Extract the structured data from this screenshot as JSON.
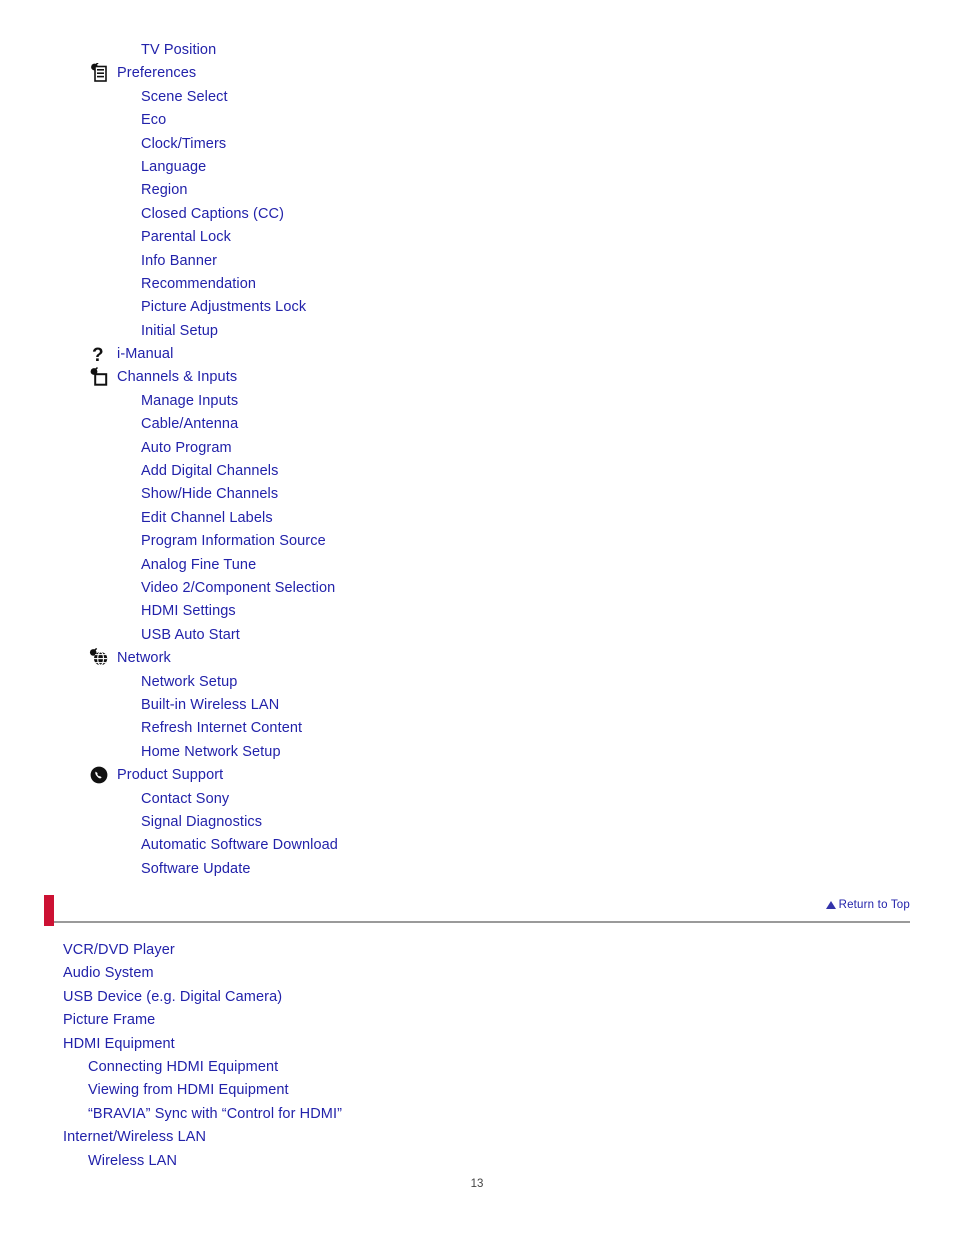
{
  "document": {
    "page_number": "13",
    "link_color": "#2222AA",
    "accent_bar_color": "#CC1133",
    "rule_color": "#9A9A9A"
  },
  "toc_top": {
    "items": [
      {
        "label": "TV Position",
        "level": "sub",
        "icon": null
      },
      {
        "label": "Preferences",
        "level": "icon",
        "icon": "preferences-list-icon"
      },
      {
        "label": "Scene Select",
        "level": "sub",
        "icon": null
      },
      {
        "label": "Eco",
        "level": "sub",
        "icon": null
      },
      {
        "label": "Clock/Timers",
        "level": "sub",
        "icon": null
      },
      {
        "label": "Language",
        "level": "sub",
        "icon": null
      },
      {
        "label": "Region",
        "level": "sub",
        "icon": null
      },
      {
        "label": "Closed Captions (CC)",
        "level": "sub",
        "icon": null
      },
      {
        "label": "Parental Lock",
        "level": "sub",
        "icon": null
      },
      {
        "label": "Info Banner",
        "level": "sub",
        "icon": null
      },
      {
        "label": "Recommendation",
        "level": "sub",
        "icon": null
      },
      {
        "label": "Picture Adjustments Lock",
        "level": "sub",
        "icon": null
      },
      {
        "label": "Initial Setup",
        "level": "sub",
        "icon": null
      },
      {
        "label": "i-Manual",
        "level": "icon",
        "icon": "question-mark-icon"
      },
      {
        "label": "Channels & Inputs",
        "level": "icon",
        "icon": "channels-inputs-icon"
      },
      {
        "label": "Manage Inputs",
        "level": "sub",
        "icon": null
      },
      {
        "label": "Cable/Antenna",
        "level": "sub",
        "icon": null
      },
      {
        "label": "Auto Program",
        "level": "sub",
        "icon": null
      },
      {
        "label": "Add Digital Channels",
        "level": "sub",
        "icon": null
      },
      {
        "label": "Show/Hide Channels",
        "level": "sub",
        "icon": null
      },
      {
        "label": "Edit Channel Labels",
        "level": "sub",
        "icon": null
      },
      {
        "label": "Program Information Source",
        "level": "sub",
        "icon": null
      },
      {
        "label": "Analog Fine Tune",
        "level": "sub",
        "icon": null
      },
      {
        "label": "Video 2/Component Selection",
        "level": "sub",
        "icon": null
      },
      {
        "label": "HDMI Settings",
        "level": "sub",
        "icon": null
      },
      {
        "label": "USB Auto Start",
        "level": "sub",
        "icon": null
      },
      {
        "label": "Network",
        "level": "icon",
        "icon": "globe-icon"
      },
      {
        "label": "Network Setup",
        "level": "sub",
        "icon": null
      },
      {
        "label": "Built-in Wireless LAN",
        "level": "sub",
        "icon": null
      },
      {
        "label": "Refresh Internet Content",
        "level": "sub",
        "icon": null
      },
      {
        "label": "Home Network Setup",
        "level": "sub",
        "icon": null
      },
      {
        "label": "Product Support",
        "level": "icon",
        "icon": "phone-icon"
      },
      {
        "label": "Contact Sony",
        "level": "sub",
        "icon": null
      },
      {
        "label": "Signal Diagnostics",
        "level": "sub",
        "icon": null
      },
      {
        "label": "Automatic Software Download",
        "level": "sub",
        "icon": null
      },
      {
        "label": "Software Update",
        "level": "sub",
        "icon": null
      }
    ]
  },
  "return_to_top": {
    "label": "Return to Top",
    "icon": "triangle-up-icon"
  },
  "toc_bottom": {
    "items": [
      {
        "label": "VCR/DVD Player",
        "level": "1"
      },
      {
        "label": "Audio System",
        "level": "1"
      },
      {
        "label": "USB Device (e.g. Digital Camera)",
        "level": "1"
      },
      {
        "label": "Picture Frame",
        "level": "1"
      },
      {
        "label": "HDMI Equipment",
        "level": "1"
      },
      {
        "label": "Connecting HDMI Equipment",
        "level": "2"
      },
      {
        "label": "Viewing from HDMI Equipment",
        "level": "2"
      },
      {
        "label": "“BRAVIA” Sync with “Control for HDMI”",
        "level": "2"
      },
      {
        "label": "Internet/Wireless LAN",
        "level": "1"
      },
      {
        "label": "Wireless LAN",
        "level": "2"
      }
    ]
  }
}
